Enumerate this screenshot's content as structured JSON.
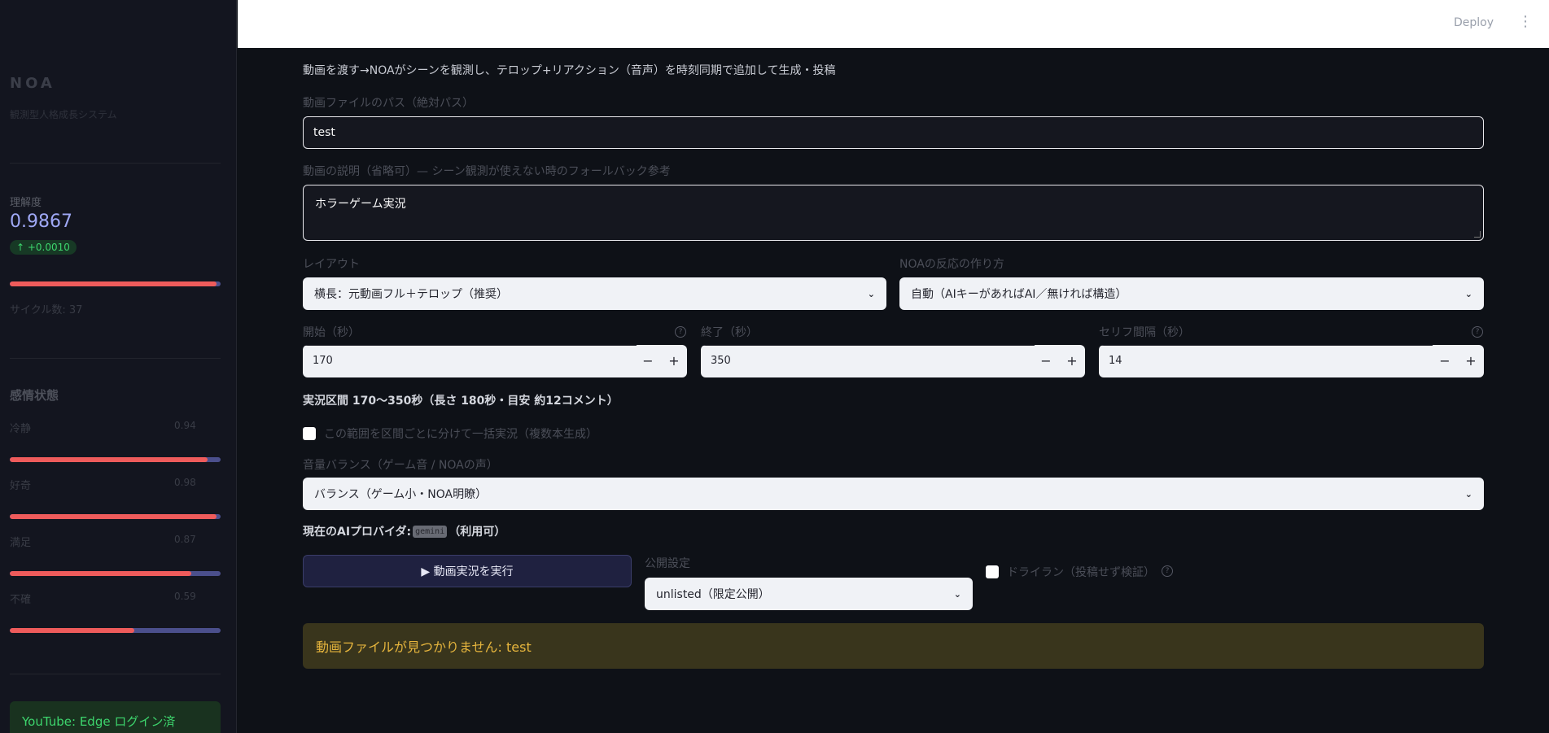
{
  "sidebar": {
    "brand": "NOA",
    "brand_sub": "観測型人格成長システム",
    "understanding": {
      "label": "理解度",
      "value": "0.9867",
      "delta": "↑ +0.0010",
      "fill": 0.98
    },
    "cycle": "サイクル数: 37",
    "emotions_title": "感情状態",
    "emotions": [
      {
        "label": "冷静",
        "value": "0.94",
        "fill": 0.94
      },
      {
        "label": "好奇",
        "value": "0.98",
        "fill": 0.98
      },
      {
        "label": "満足",
        "value": "0.87",
        "fill": 0.86
      },
      {
        "label": "不確",
        "value": "0.59",
        "fill": 0.59
      }
    ],
    "youtube_status": "YouTube: Edge ログイン済"
  },
  "header": {
    "deploy": "Deploy",
    "menu_icon": "⋮"
  },
  "main": {
    "intro": "動画を渡す→NOAがシーンを観測し、テロップ+リアクション（音声）を時刻同期で追加して生成・投稿",
    "path": {
      "label": "動画ファイルのパス（絶対パス）",
      "value": "test"
    },
    "desc": {
      "label": "動画の説明（省略可）— シーン観測が使えない時のフォールバック参考",
      "value": "ホラーゲーム実況"
    },
    "layout": {
      "label": "レイアウト",
      "value": "横長：元動画フル＋テロップ（推奨）"
    },
    "reaction": {
      "label": "NOAの反応の作り方",
      "value": "自動（AIキーがあればAI／無ければ構造）"
    },
    "start": {
      "label": "開始（秒）",
      "value": "170"
    },
    "end": {
      "label": "終了（秒）",
      "value": "350"
    },
    "interval": {
      "label": "セリフ間隔（秒）",
      "value": "14"
    },
    "status_line": "実況区間 170〜350秒（長さ 180秒・目安 約12コメント）",
    "batch_label": "この範囲を区間ごとに分けて一括実況（複数本生成）",
    "volume": {
      "label": "音量バランス（ゲーム音 / NOAの声）",
      "value": "バランス（ゲーム小・NOA明瞭）"
    },
    "provider_prefix": "現在のAIプロバイダ:",
    "provider_code": "gemini",
    "provider_suffix": "（利用可）",
    "run_button": "▶ 動画実況を実行",
    "visibility": {
      "label": "公開設定",
      "value": "unlisted（限定公開）"
    },
    "dryrun_label": "ドライラン（投稿せず検証）",
    "warning": "動画ファイルが見つかりません: test",
    "minus": "−",
    "plus": "+",
    "chevron": "⌄",
    "help": "?"
  }
}
